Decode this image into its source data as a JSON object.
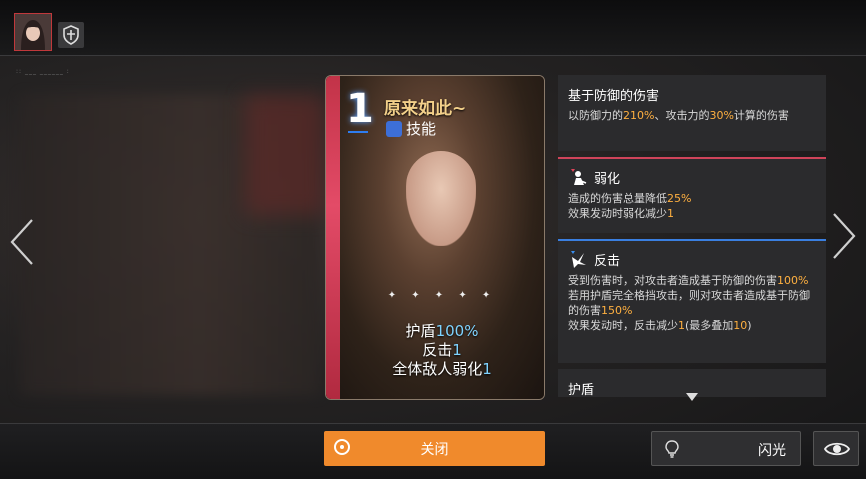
{
  "header": {
    "avatar_icon": "character-portrait",
    "shield_icon": "shield-cross-icon",
    "subtitle": ":: ___ ______ :"
  },
  "card": {
    "cost": "1",
    "name": "原来如此~",
    "type_icon": "skill-type-icon",
    "type_label": "技能",
    "sparkle": "✦ ✦ ✦ ✦ ✦",
    "effects": [
      {
        "text": "护盾",
        "value": "100%"
      },
      {
        "text": "反击",
        "value": "1"
      },
      {
        "text": "全体敌人弱化",
        "value": "1"
      }
    ]
  },
  "side_panels": [
    {
      "title": "基于防御的伤害",
      "body_parts": [
        "以防御力的",
        "210%",
        "、攻击力的",
        "30%",
        "计算的伤害"
      ]
    },
    {
      "icon": "weaken-icon",
      "title": "弱化",
      "lines": [
        [
          "造成的伤害总量降低",
          "25%"
        ],
        [
          "效果发动时弱化减少",
          "1"
        ]
      ]
    },
    {
      "icon": "counter-icon",
      "title": "反击",
      "lines": [
        [
          "受到伤害时，对攻击者造成基于防御的伤害",
          "100%"
        ],
        [
          "若用护盾完全格挡攻击，则对攻击者造成基于防御的伤害",
          "150%"
        ],
        [
          "效果发动时，反击减少",
          "1",
          "(最多叠加",
          "10",
          ")"
        ]
      ]
    },
    {
      "title": "护盾"
    }
  ],
  "footer": {
    "close_label": "关闭",
    "flash_label": "闪光",
    "flash_icon": "lightbulb-icon",
    "eye_icon": "eye-icon"
  },
  "colors": {
    "accent_orange": "#f08a2c",
    "highlight_number": "#ffb040",
    "card_value": "#7fd3ff",
    "weaken_border": "#d0445a",
    "counter_border": "#3a7fe0"
  }
}
